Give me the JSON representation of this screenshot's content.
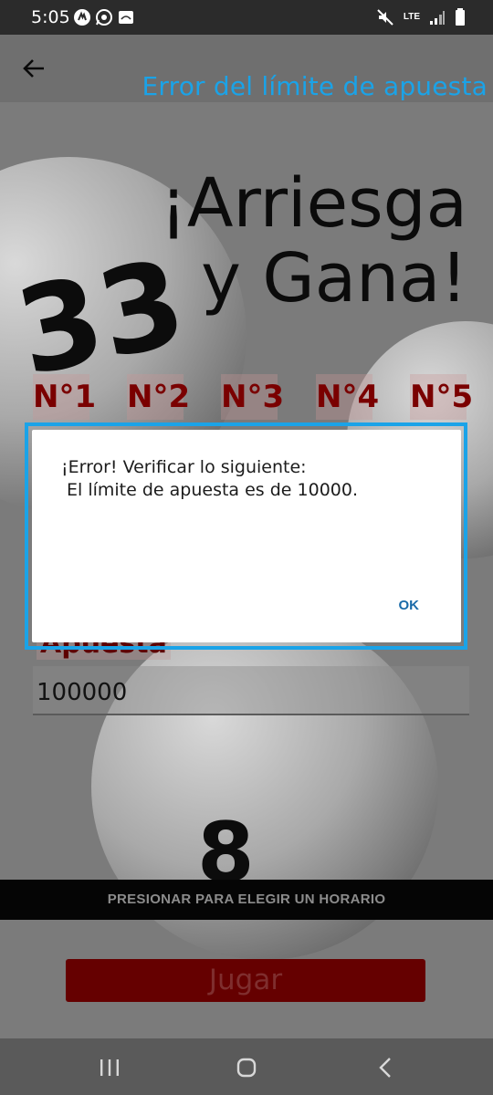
{
  "status_bar": {
    "time": "5:05",
    "network": "LTE",
    "icons": [
      "messenger-icon",
      "whatsapp-icon",
      "screen-icon",
      "mute-icon",
      "signal-icon",
      "battery-icon"
    ]
  },
  "app_bar": {
    "title": "Error del límite de apuesta"
  },
  "background": {
    "headline_line1": "¡Arriesga",
    "headline_line2": "y Gana!",
    "ball_numbers": [
      "33",
      "8"
    ],
    "numbers": [
      "N°1",
      "N°2",
      "N°3",
      "N°4",
      "N°5"
    ],
    "bet_label": "Apuesta",
    "bet_value": "100000",
    "schedule_button": "PRESIONAR PARA ELEGIR UN HORARIO",
    "play_button": "Jugar"
  },
  "dialog": {
    "title": "¡Error! Verificar lo siguiente:",
    "message": "El límite de apuesta es de 10000.",
    "ok_label": "OK"
  },
  "colors": {
    "accent_blue": "#1aa3e8",
    "number_red": "#7a0000",
    "play_button": "#650000"
  }
}
